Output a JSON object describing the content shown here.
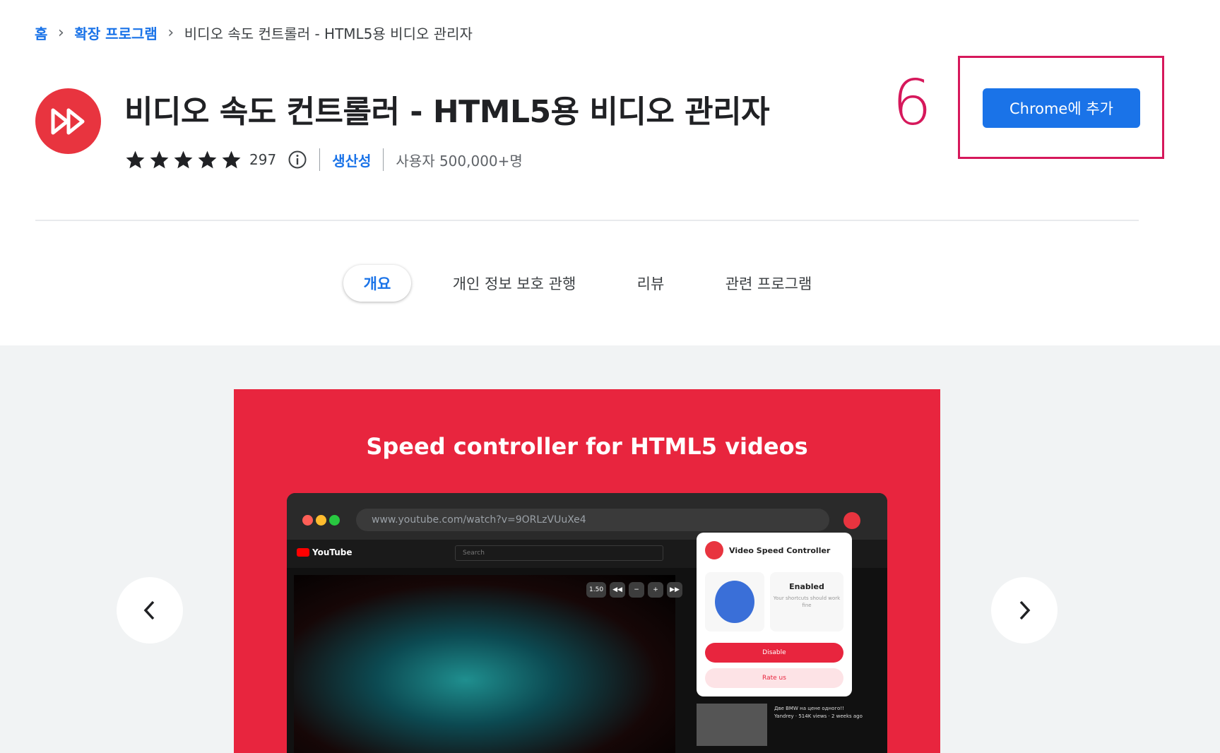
{
  "breadcrumb": {
    "home": "홈",
    "extensions": "확장 프로그램",
    "current": "비디오 속도 컨트롤러 - HTML5용 비디오 관리자",
    "separator": "›"
  },
  "app": {
    "title": "비디오 속도 컨트롤러 - HTML5용 비디오 관리자",
    "rating": 5,
    "rating_count": "297",
    "category": "생산성",
    "users": "사용자 500,000+명",
    "icon": "fast-forward-icon",
    "brand_color": "#e8343f"
  },
  "annotation": {
    "number": "6",
    "color": "#d6185b"
  },
  "actions": {
    "add_button_label": "Chrome에 추가",
    "accent": "#1a73e8"
  },
  "tabs": [
    {
      "label": "개요",
      "active": true
    },
    {
      "label": "개인 정보 보호 관행",
      "active": false
    },
    {
      "label": "리뷰",
      "active": false
    },
    {
      "label": "관련 프로그램",
      "active": false
    }
  ],
  "gallery": {
    "slide_heading": "Speed controller for HTML5 videos",
    "url": "www.youtube.com/watch?v=9ORLzVUuXe4",
    "yt_brand": "YouTube",
    "yt_search_placeholder": "Search",
    "speed_value": "1.50",
    "popup_title": "Video Speed Controller",
    "popup_status": "Enabled",
    "popup_status_sub": "Your shortcuts should work fine",
    "popup_disable": "Disable",
    "popup_rate": "Rate us",
    "sidebar_video_title": "Две BMW на цене одного!!",
    "sidebar_video_meta": "Yandrey · 514K views · 2 weeks ago",
    "slide_color": "#e8253e"
  }
}
